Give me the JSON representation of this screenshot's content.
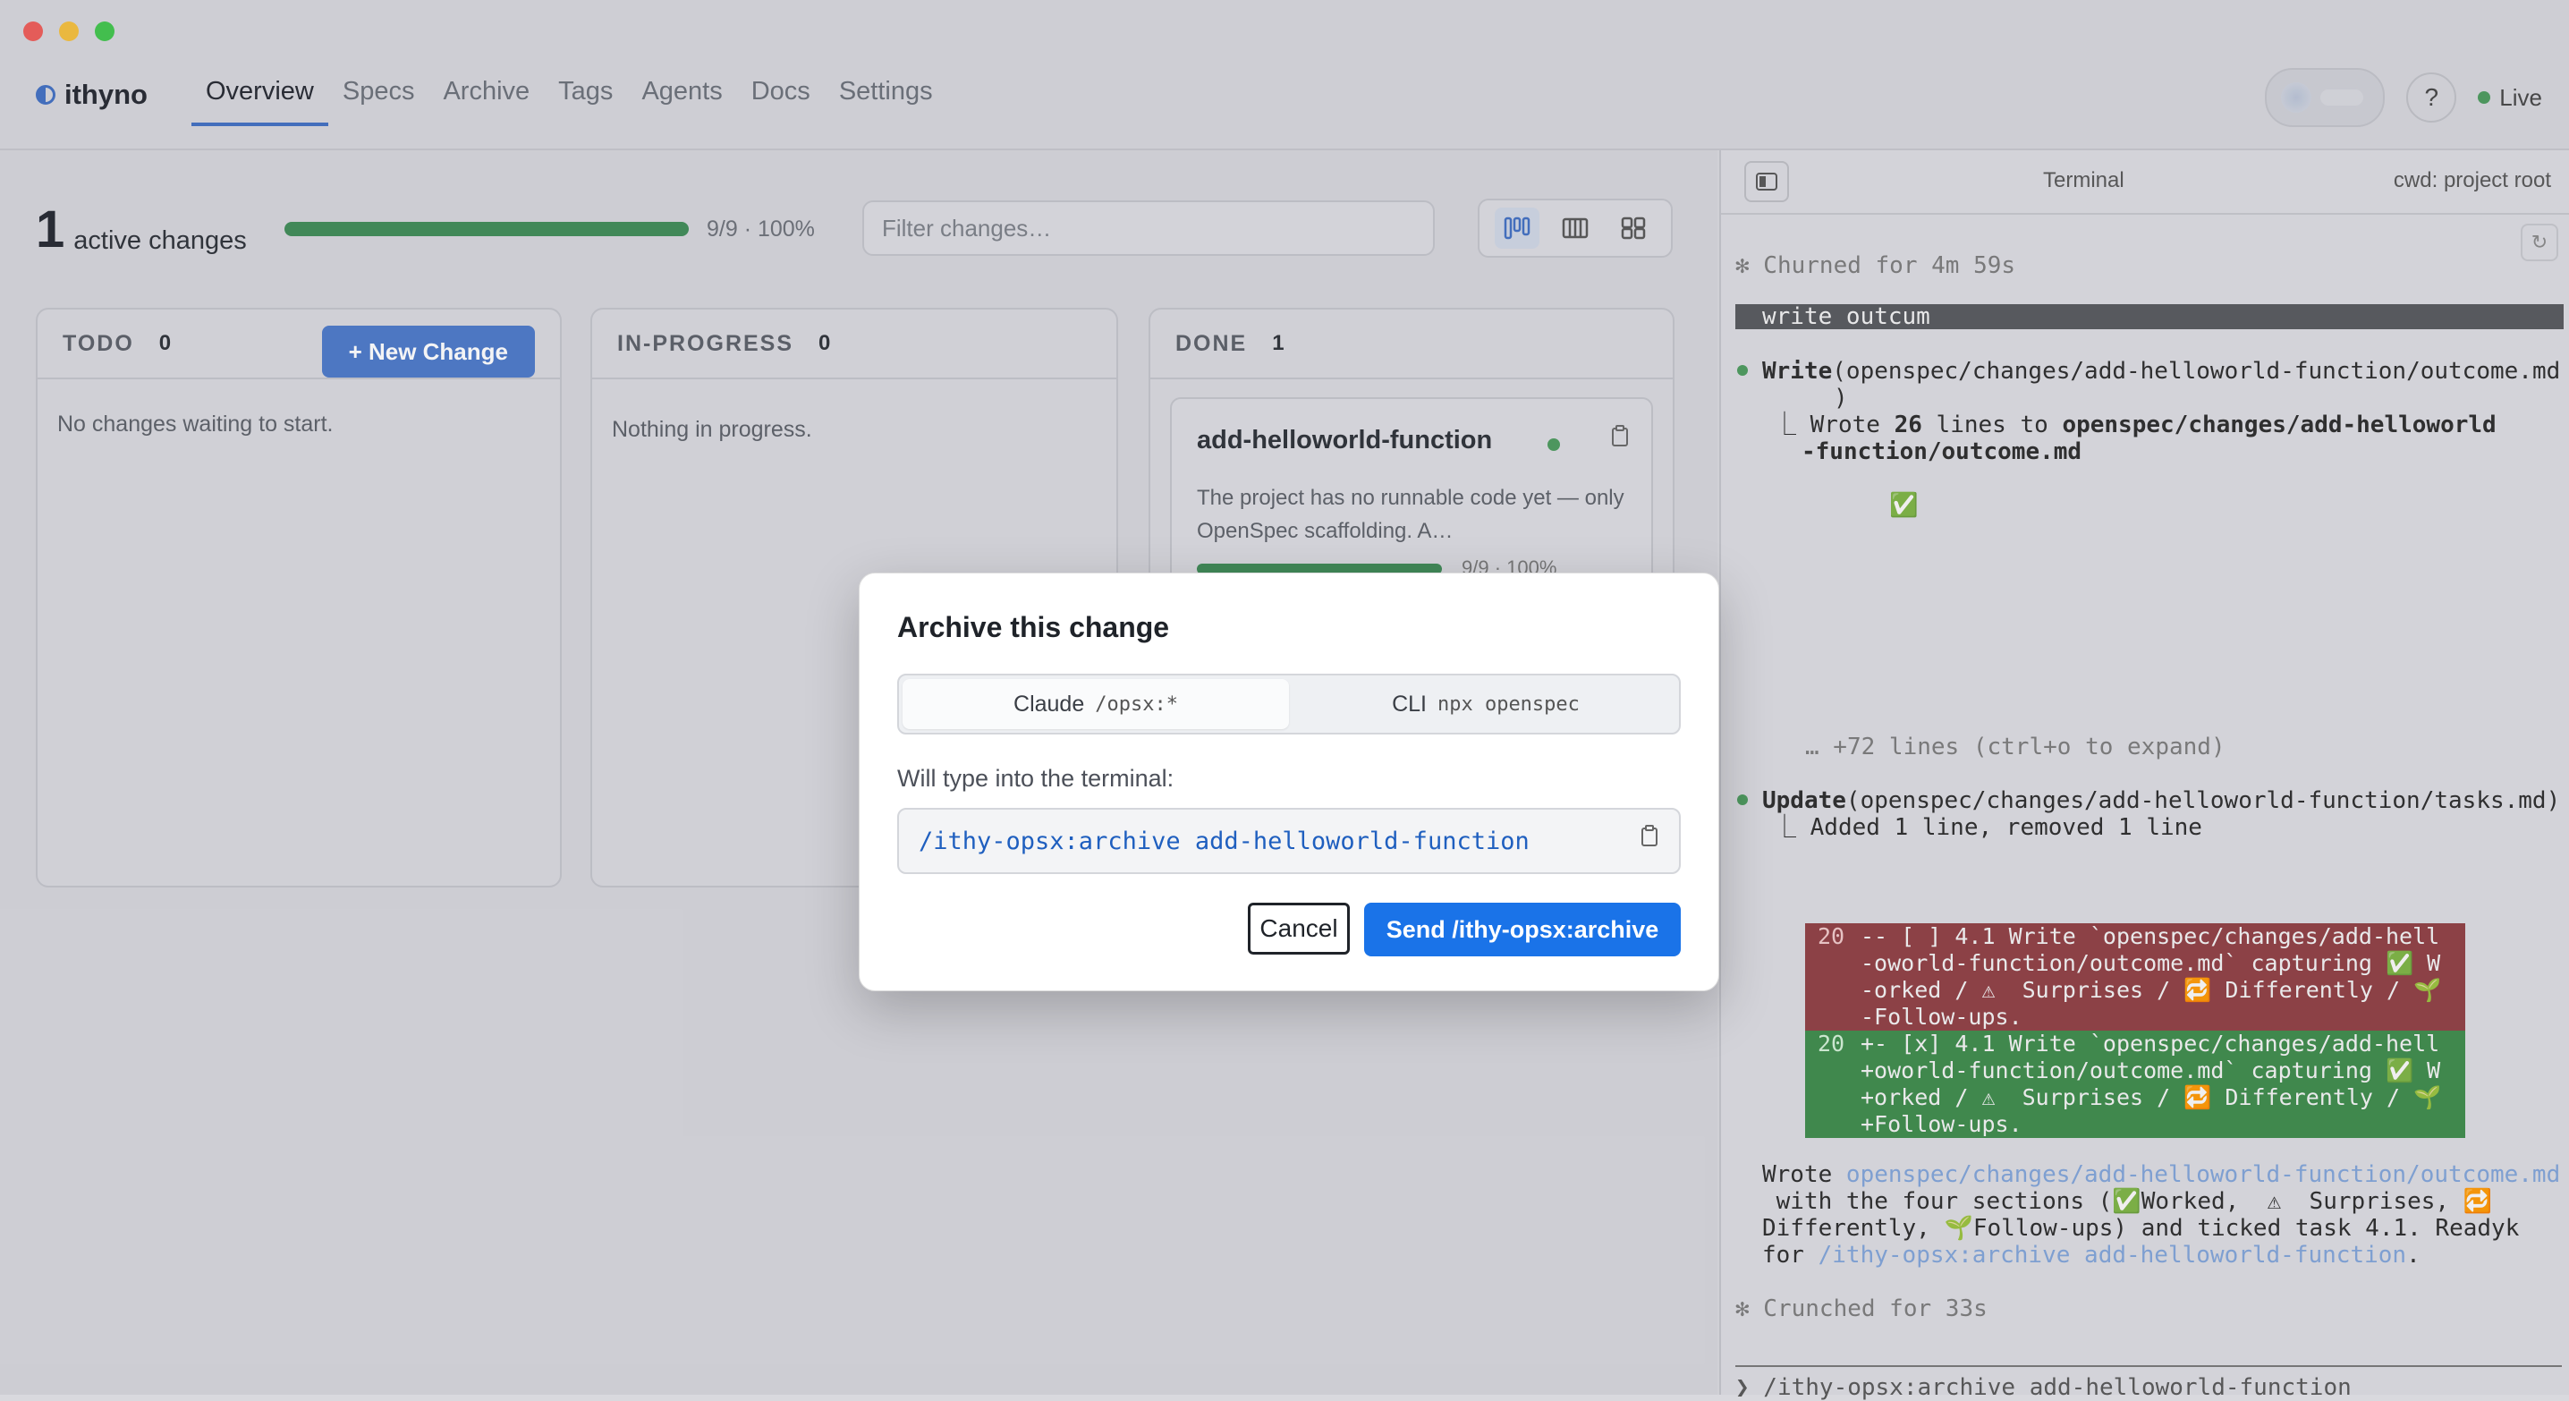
{
  "app": {
    "name": "ithyno"
  },
  "nav": {
    "items": [
      "Overview",
      "Specs",
      "Archive",
      "Tags",
      "Agents",
      "Docs",
      "Settings"
    ],
    "active": "Overview"
  },
  "header": {
    "help": "?",
    "live": "Live"
  },
  "stats": {
    "count": "1",
    "label": "active changes",
    "progress_text": "9/9 · 100%",
    "progress": 1.0
  },
  "filter": {
    "placeholder": "Filter changes…"
  },
  "columns": {
    "todo": {
      "title": "TODO",
      "count": "0",
      "empty": "No changes waiting to start.",
      "new_button": "+ New Change"
    },
    "inprogress": {
      "title": "IN-PROGRESS",
      "count": "0",
      "empty": "Nothing in progress."
    },
    "done": {
      "title": "DONE",
      "count": "1"
    }
  },
  "card": {
    "name": "add-helloworld-function",
    "desc": "The project has no runnable code yet — only OpenSpec scaffolding. A…",
    "progress_text": "9/9 · 100%",
    "progress": 1.0
  },
  "terminal": {
    "title": "Terminal",
    "cwd": "cwd: project root",
    "lines": {
      "churned": "✻ Churned for 4m 59s",
      "write_bar": "write outcum",
      "write_call_name": "Write",
      "write_call_args": "(openspec/changes/add-helloworld-function/outcome.md",
      "write_call_close": ")",
      "wrote_prefix": "⎿ Wrote ",
      "wrote_count": "26",
      "wrote_mid": " lines to ",
      "wrote_path1": "openspec/changes/add-helloworld",
      "wrote_path2": "-function/outcome.md",
      "check": "✅",
      "more": "… +72 lines (ctrl+o to expand)",
      "update_name": "Update",
      "update_args": "(openspec/changes/add-helloworld-function/tasks.md)",
      "added": "⎿ Added 1 line, removed 1 line",
      "summary_1a": "Wrote ",
      "summary_1b": "openspec/changes/add-helloworld-function/outcome.md",
      "summary_2": " with the four sections (✅Worked,  ⚠  Surprises, 🔁",
      "summary_3": "Differently, 🌱Follow-ups) and ticked task 4.1. Readyk",
      "summary_4a": "for ",
      "summary_4b": "/ithy-opsx:archive add-helloworld-function",
      "summary_4c": ".",
      "crunched": "✻ Crunched for 33s",
      "prompt": "❯ /ithy-opsx:archive add-helloworld-function"
    },
    "diff_del": {
      "line_no": "20",
      "lines": [
        "-- [ ] 4.1 Write `openspec/changes/add-hell",
        "-oworld-function/outcome.md` capturing ✅ W",
        "-orked / ⚠  Surprises / 🔁 Differently / 🌱",
        "-Follow-ups."
      ]
    },
    "diff_add": {
      "line_no": "20",
      "lines": [
        "+- [x] 4.1 Write `openspec/changes/add-hell",
        "+oworld-function/outcome.md` capturing ✅ W",
        "+orked / ⚠  Surprises / 🔁 Differently / 🌱",
        "+Follow-ups."
      ]
    }
  },
  "modal": {
    "title": "Archive this change",
    "tabs": [
      {
        "label": "Claude",
        "code": "/opsx:*"
      },
      {
        "label": "CLI",
        "code": "npx openspec"
      }
    ],
    "hint": "Will type into the terminal:",
    "command": "/ithy-opsx:archive add-helloworld-function",
    "cancel": "Cancel",
    "send": "Send /ithy-opsx:archive"
  },
  "colors": {
    "accent": "#3f6ec2",
    "primary_button": "#1a73e8",
    "success": "#3d8a55",
    "diff_del": "#8f3d42",
    "diff_add": "#3c8a49"
  }
}
